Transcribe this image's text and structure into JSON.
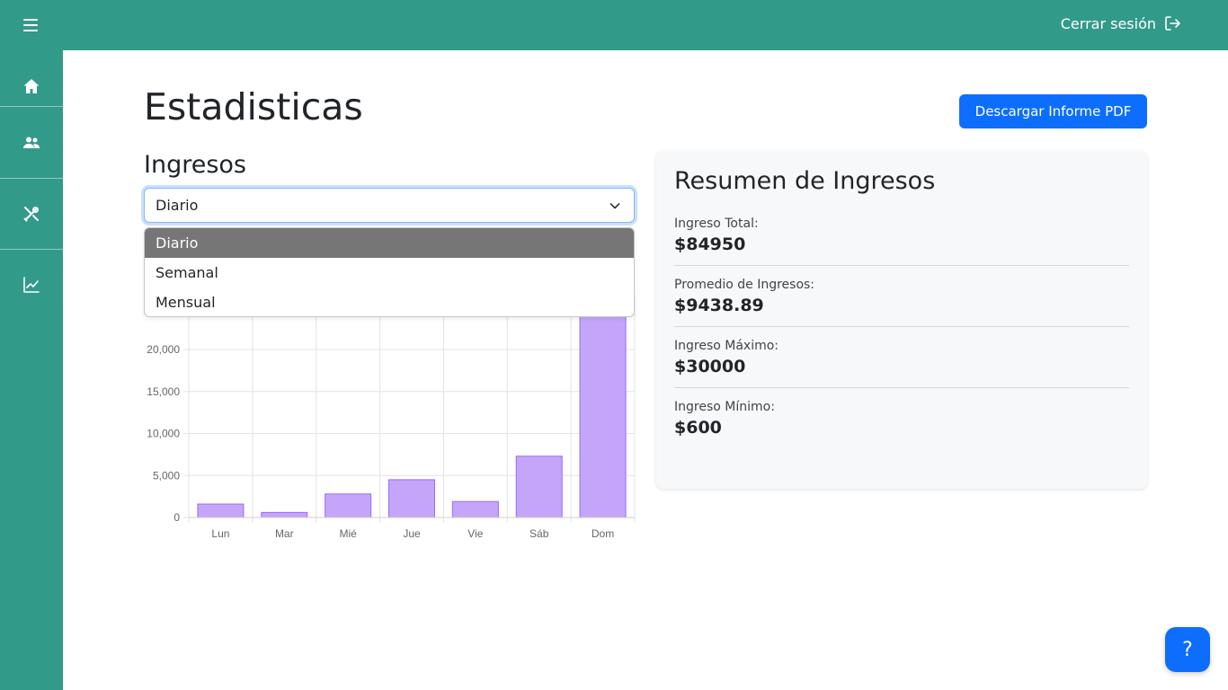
{
  "header": {
    "logout_label": "Cerrar sesión"
  },
  "sidebar": {
    "items": [
      "home-icon",
      "users-icon",
      "tools-icon",
      "chart-line-icon"
    ]
  },
  "page": {
    "title": "Estadisticas",
    "pdf_button": "Descargar Informe PDF"
  },
  "ingresos": {
    "title": "Ingresos",
    "selected": "Diario",
    "options": [
      "Diario",
      "Semanal",
      "Mensual"
    ]
  },
  "chart_data": {
    "type": "bar",
    "categories": [
      "Lun",
      "Mar",
      "Mié",
      "Jue",
      "Vie",
      "Sáb",
      "Dom"
    ],
    "values": [
      1600,
      600,
      2800,
      4500,
      1900,
      7300,
      30000
    ],
    "yticks": [
      0,
      5000,
      10000,
      15000,
      20000
    ],
    "ylim": [
      0,
      25000
    ],
    "bar_color": "#c4a5fa",
    "bar_border": "#9b6bf2",
    "grid": true
  },
  "summary": {
    "title": "Resumen de Ingresos",
    "items": [
      {
        "label": "Ingreso Total:",
        "value": "$84950"
      },
      {
        "label": "Promedio de Ingresos:",
        "value": "$9438.89"
      },
      {
        "label": "Ingreso Máximo:",
        "value": "$30000"
      },
      {
        "label": "Ingreso Mínimo:",
        "value": "$600"
      }
    ]
  },
  "help": {
    "label": "?"
  },
  "colors": {
    "brand": "#329a89",
    "primary": "#0d6efd"
  }
}
